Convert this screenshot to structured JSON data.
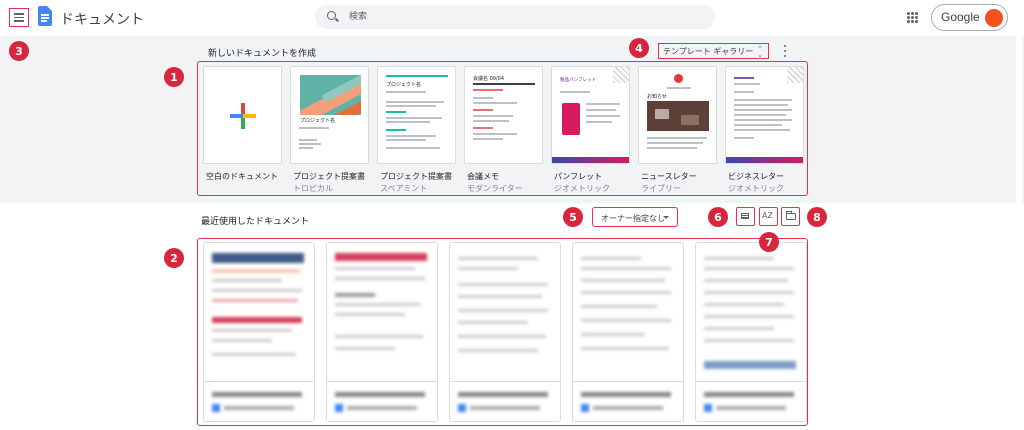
{
  "app": {
    "title": "ドキュメント"
  },
  "search": {
    "placeholder": "検索"
  },
  "account": {
    "label": "Google"
  },
  "templates": {
    "section_title": "新しいドキュメントを作成",
    "gallery_label": "テンプレート ギャラリー",
    "items": [
      {
        "name": "空白のドキュメント",
        "sub": ""
      },
      {
        "name": "プロジェクト提案書",
        "sub": "トロピカル",
        "thumb_heading": "プロジェクト名"
      },
      {
        "name": "プロジェクト提案書",
        "sub": "スペアミント",
        "thumb_heading": "プロジェクト名"
      },
      {
        "name": "会議メモ",
        "sub": "モダンライター",
        "thumb_heading": "会議名 09/04"
      },
      {
        "name": "パンフレット",
        "sub": "ジオメトリック",
        "thumb_heading": "製品パンフレット"
      },
      {
        "name": "ニュースレター",
        "sub": "ライブリー",
        "thumb_heading": "お知らせ"
      },
      {
        "name": "ビジネスレター",
        "sub": "ジオメトリック"
      }
    ]
  },
  "recent": {
    "section_title": "最近使用したドキュメント",
    "owner_filter": "オーナー指定なし",
    "sort_icon_label": "AZ"
  },
  "annotations": [
    "1",
    "2",
    "3",
    "4",
    "5",
    "6",
    "7",
    "8"
  ],
  "colors": {
    "accent_red": "#e8304e",
    "badge_red": "#d7263d",
    "docs_blue": "#4285f4",
    "section_bg": "#f1f3f4"
  }
}
